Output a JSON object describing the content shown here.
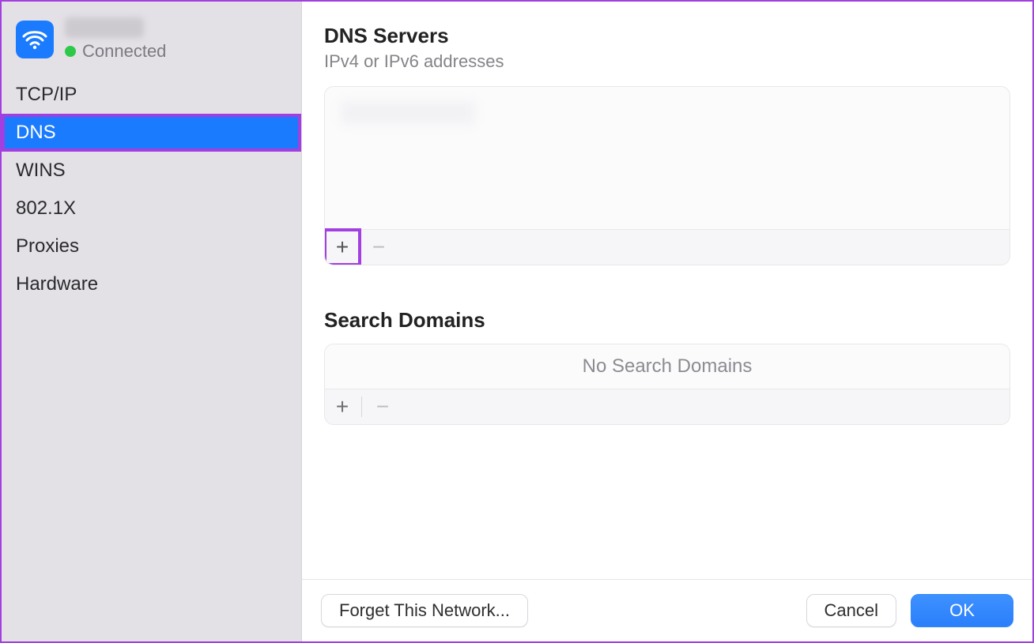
{
  "sidebar": {
    "network_name": "",
    "status_label": "Connected",
    "items": [
      {
        "label": "TCP/IP",
        "selected": false
      },
      {
        "label": "DNS",
        "selected": true
      },
      {
        "label": "WINS",
        "selected": false
      },
      {
        "label": "802.1X",
        "selected": false
      },
      {
        "label": "Proxies",
        "selected": false
      },
      {
        "label": "Hardware",
        "selected": false
      }
    ]
  },
  "dns_section": {
    "title": "DNS Servers",
    "subtitle": "IPv4 or IPv6 addresses",
    "entries_redacted": true,
    "add_label": "+",
    "remove_label": "−"
  },
  "search_section": {
    "title": "Search Domains",
    "empty_text": "No Search Domains",
    "add_label": "+",
    "remove_label": "−"
  },
  "footer": {
    "forget_label": "Forget This Network...",
    "cancel_label": "Cancel",
    "ok_label": "OK"
  },
  "annotations": {
    "sidebar_selected_highlight": true,
    "dns_add_button_highlight": true
  }
}
